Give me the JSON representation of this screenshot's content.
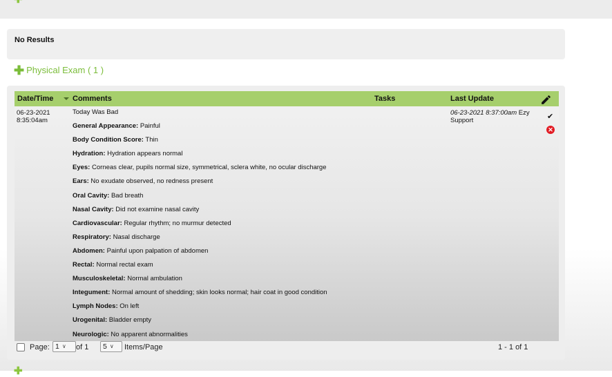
{
  "previous_panel": {
    "no_results": "No Results"
  },
  "section": {
    "title": "Physical Exam ( 1 )"
  },
  "grid": {
    "columns": {
      "datetime": "Date/Time",
      "comments": "Comments",
      "tasks": "Tasks",
      "last_update": "Last Update"
    },
    "row": {
      "date": "06-23-2021",
      "time": "8:35:04am",
      "comments": [
        {
          "label": "",
          "value": "Today Was Bad"
        },
        {
          "label": "General Appearance:",
          "value": " Painful"
        },
        {
          "label": "Body Condition Score:",
          "value": " Thin"
        },
        {
          "label": "Hydration:",
          "value": " Hydration appears normal"
        },
        {
          "label": "Eyes:",
          "value": " Corneas clear, pupils normal size, symmetrical, sclera white, no ocular discharge"
        },
        {
          "label": "Ears:",
          "value": " No exudate observed, no redness present"
        },
        {
          "label": "Oral Cavity:",
          "value": " Bad breath"
        },
        {
          "label": "Nasal Cavity:",
          "value": " Did not examine nasal cavity"
        },
        {
          "label": "Cardiovascular:",
          "value": " Regular rhythm; no murmur detected"
        },
        {
          "label": "Respiratory:",
          "value": " Nasal discharge"
        },
        {
          "label": "Abdomen:",
          "value": " Painful upon palpation of abdomen"
        },
        {
          "label": "Rectal:",
          "value": " Normal rectal exam"
        },
        {
          "label": "Musculoskeletal:",
          "value": " Normal ambulation"
        },
        {
          "label": "Integument:",
          "value": " Normal amount of shedding; skin looks normal; hair coat in good condition"
        },
        {
          "label": "Lymph Nodes:",
          "value": " On left"
        },
        {
          "label": "Urogenital:",
          "value": " Bladder empty"
        },
        {
          "label": "Neurologic:",
          "value": " No apparent abnormalities"
        }
      ],
      "last_update_date": "06-23-2021 8:37:00am",
      "last_update_by": " Ezy Support"
    }
  },
  "pager": {
    "page_label": "Page:",
    "page_value": "1",
    "of_label": "of 1",
    "per_page_value": "5",
    "items_label": "Items/Page",
    "range": "1 - 1 of 1"
  },
  "colors": {
    "accent": "#7bbd3a",
    "header": "#a6cf6c",
    "danger": "#e21b23"
  },
  "icons": [
    "plus-icon",
    "sort-arrow-icon",
    "pencil-icon",
    "check-icon",
    "delete-icon",
    "chevron-down-icon"
  ]
}
